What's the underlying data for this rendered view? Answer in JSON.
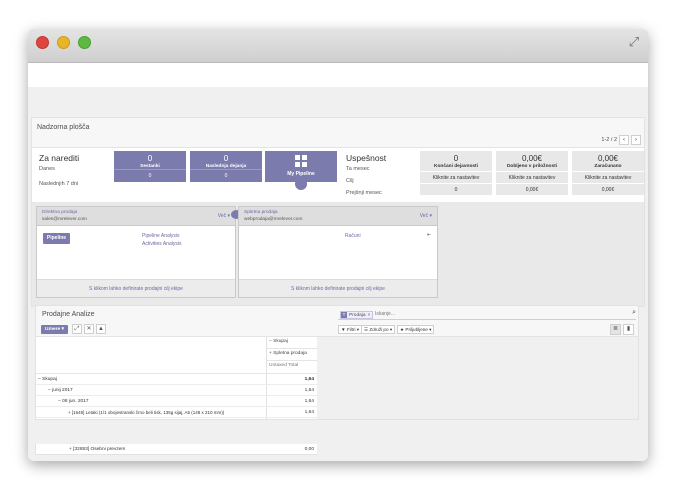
{
  "dashboard": {
    "title": "Nadzorna plošča",
    "pager": "1-2 / 2",
    "todo": {
      "title": "Za narediti",
      "today": "Danes",
      "next7": "Naslednjih 7 dni"
    },
    "kpis": [
      {
        "value": "0",
        "label": "Sestanki",
        "bottom": "0"
      },
      {
        "value": "0",
        "label": "Naslednja dejanja",
        "bottom": "0"
      }
    ],
    "pipeline_label": "My Pipeline",
    "success": {
      "title": "Uspešnost",
      "this_month": "Ta mesec",
      "target": "Cilj",
      "prev_month": "Prejšnji mesec"
    },
    "metrics": [
      {
        "value": "0",
        "label": "Končani dejavnosti",
        "mid": "Kliknite za nastavitev",
        "bottom": "0"
      },
      {
        "value": "0,00€",
        "label": "Dobljeno v priložnosti",
        "mid": "Kliknite za nastavitev",
        "bottom": "0,00€"
      },
      {
        "value": "0,00€",
        "label": "Zaračunano",
        "mid": "Kliknite za nastavitev",
        "bottom": "0,00€"
      }
    ],
    "teams": [
      {
        "name": "Direktna prodaja",
        "email": "sales@mrelever.com",
        "more": "Več ▾",
        "button": "Pipeline",
        "links": [
          "Pipeline Analysis",
          "Activities Analysis"
        ],
        "footer": "S klikom lahko definirate prodajni cilj ekipe"
      },
      {
        "name": "Spletna prodaja",
        "email": "webprodaja@mrelever.com",
        "more": "Več ▾",
        "links": [
          "Računi"
        ],
        "footer": "S klikom lahko definirate prodajni cilj ekipe"
      }
    ]
  },
  "analysis": {
    "title": "Prodajne Analize",
    "measures_btn": "Izmere ▾",
    "search": {
      "facet": "Prodaja",
      "placeholder": "Iskanje..."
    },
    "filters": [
      "▼ Filtri ▾",
      "☰ Združi po ▾",
      "★ Priljubljene ▾"
    ],
    "header": {
      "total": "Skupaj",
      "web": "Spletna prodaja",
      "measure": "Untaxed Total"
    },
    "rows": [
      {
        "label": "Skupaj",
        "value": "1,64",
        "indent": 0,
        "sign": "−"
      },
      {
        "label": "junij 2017",
        "value": "1,64",
        "indent": 1,
        "sign": "−"
      },
      {
        "label": "08 jun. 2017",
        "value": "1,64",
        "indent": 2,
        "sign": "−"
      },
      {
        "label": "[1646] Letaki (1/1 obojestranski črno beli tisk, 135g sijaj, A5 (148 x 210 mm))",
        "value": "1,64",
        "indent": 3,
        "sign": "+"
      },
      {
        "label": "[32853] Osebni prevzem",
        "value": "0,00",
        "indent": 3,
        "sign": "+"
      }
    ]
  }
}
